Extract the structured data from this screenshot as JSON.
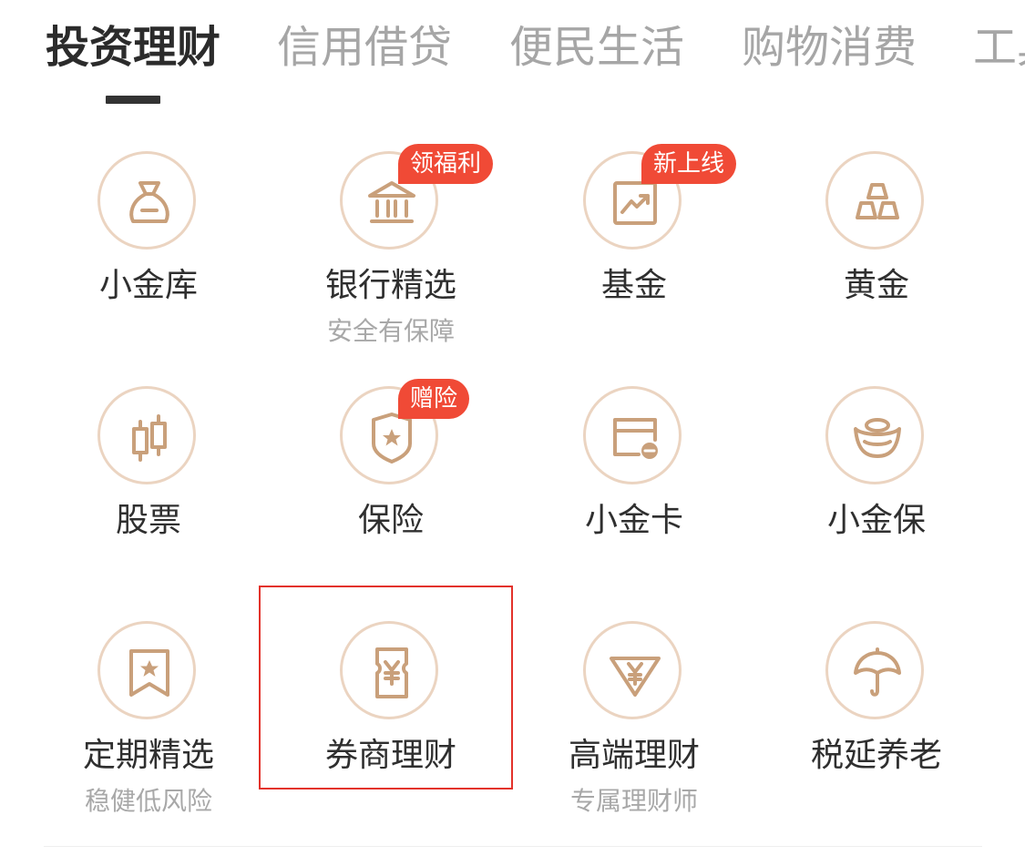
{
  "tabs": [
    {
      "label": "投资理财",
      "active": true
    },
    {
      "label": "信用借贷",
      "active": false
    },
    {
      "label": "便民生活",
      "active": false
    },
    {
      "label": "购物消费",
      "active": false
    },
    {
      "label": "工具",
      "active": false
    }
  ],
  "items": [
    {
      "label": "小金库",
      "sublabel": "",
      "badge": "",
      "icon": "money-bag-icon"
    },
    {
      "label": "银行精选",
      "sublabel": "安全有保障",
      "badge": "领福利",
      "icon": "bank-icon"
    },
    {
      "label": "基金",
      "sublabel": "",
      "badge": "新上线",
      "icon": "fund-chart-icon"
    },
    {
      "label": "黄金",
      "sublabel": "",
      "badge": "",
      "icon": "gold-bars-icon"
    },
    {
      "label": "股票",
      "sublabel": "",
      "badge": "",
      "icon": "candlestick-icon"
    },
    {
      "label": "保险",
      "sublabel": "",
      "badge": "赠险",
      "icon": "shield-star-icon"
    },
    {
      "label": "小金卡",
      "sublabel": "",
      "badge": "",
      "icon": "card-icon"
    },
    {
      "label": "小金保",
      "sublabel": "",
      "badge": "",
      "icon": "gold-ingot-icon"
    },
    {
      "label": "定期精选",
      "sublabel": "稳健低风险",
      "badge": "",
      "icon": "bookmark-star-icon"
    },
    {
      "label": "券商理财",
      "sublabel": "",
      "badge": "",
      "icon": "yuan-ticket-icon"
    },
    {
      "label": "高端理财",
      "sublabel": "专属理财师",
      "badge": "",
      "icon": "diamond-yuan-icon"
    },
    {
      "label": "税延养老",
      "sublabel": "",
      "badge": "",
      "icon": "umbrella-icon"
    }
  ],
  "colors": {
    "icon_stroke": "#c9a07b",
    "circle_border": "#ebd4c1",
    "badge_bg": "#f04a36",
    "highlight_border": "#e3322b"
  }
}
